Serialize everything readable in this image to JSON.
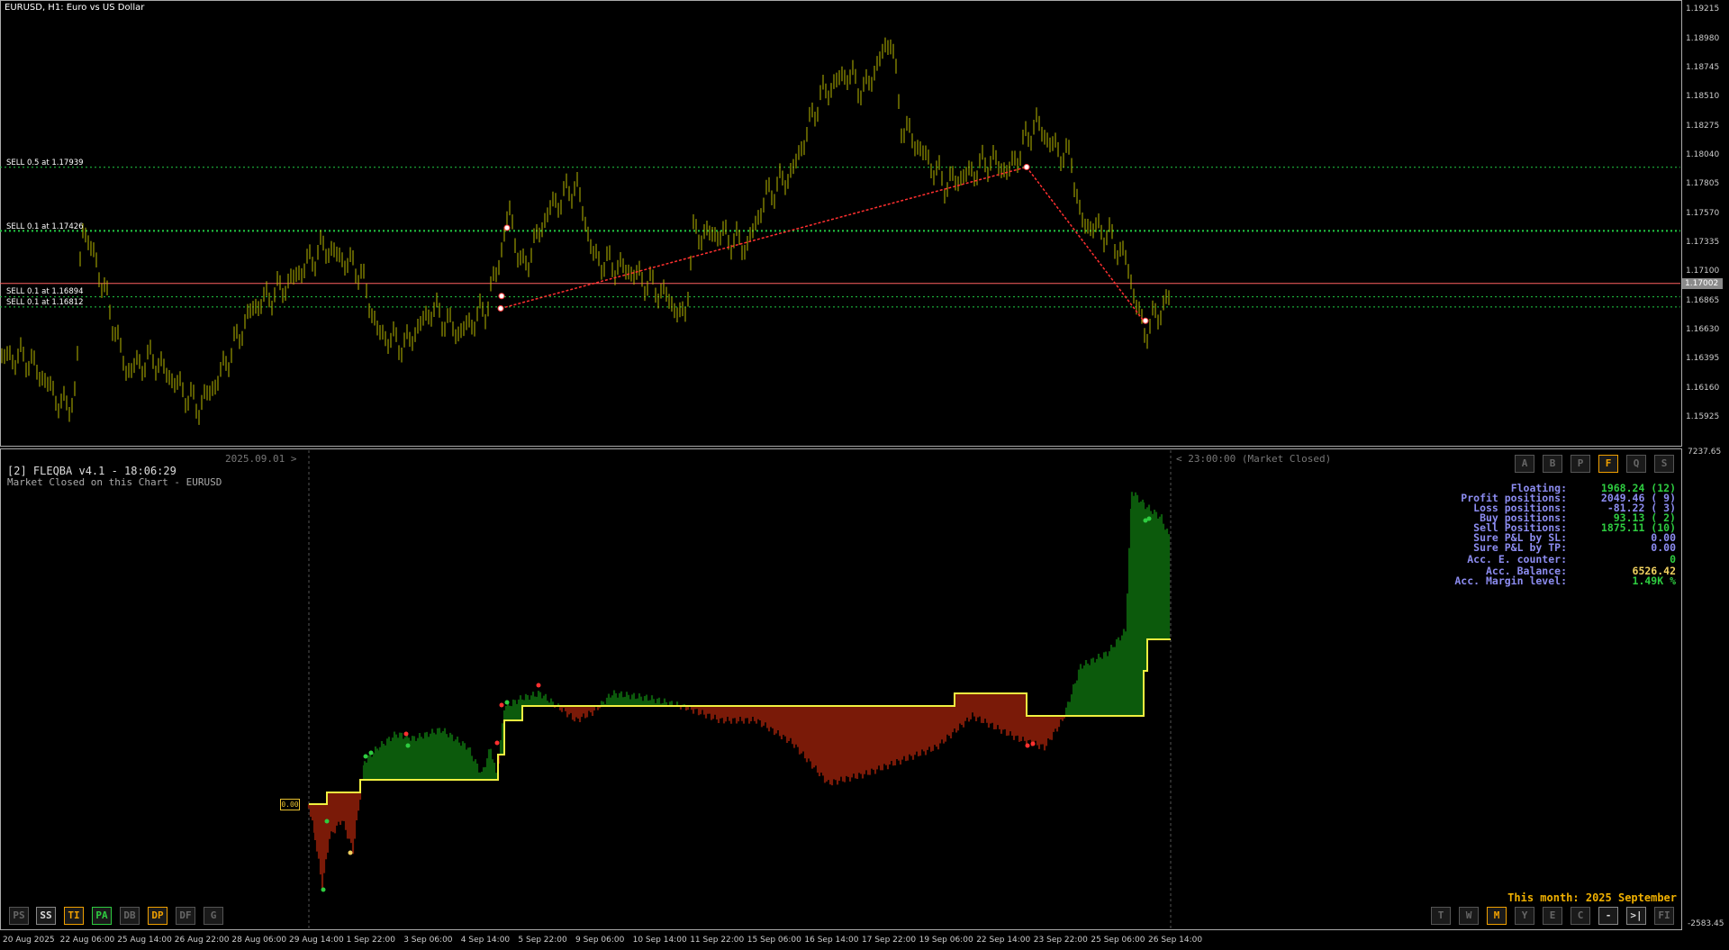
{
  "chart": {
    "title": "EURUSD, H1:  Euro vs US Dollar",
    "current_price": "1.17002",
    "price_ticks": [
      "1.19215",
      "1.18980",
      "1.18745",
      "1.18510",
      "1.18275",
      "1.18040",
      "1.17805",
      "1.17570",
      "1.17335",
      "1.17100",
      "1.16865",
      "1.16630",
      "1.16395",
      "1.16160",
      "1.15925"
    ],
    "sell_levels": [
      {
        "label": "SELL 0.5 at 1.17939",
        "price": 1.17939
      },
      {
        "label": "SELL 0.1 at 1.17426",
        "price": 1.17426
      },
      {
        "label": "SELL 0.1 at 1.16894",
        "price": 1.16894
      },
      {
        "label": "SELL 0.1 at 1.16812",
        "price": 1.16812
      }
    ],
    "time_ticks": [
      "20 Aug 2025",
      "22 Aug 06:00",
      "25 Aug 14:00",
      "26 Aug 22:00",
      "28 Aug 06:00",
      "29 Aug 14:00",
      "1 Sep 22:00",
      "3 Sep 06:00",
      "4 Sep 14:00",
      "5 Sep 22:00",
      "9 Sep 06:00",
      "10 Sep 14:00",
      "11 Sep 22:00",
      "15 Sep 06:00",
      "16 Sep 14:00",
      "17 Sep 22:00",
      "19 Sep 06:00",
      "22 Sep 14:00",
      "23 Sep 22:00",
      "25 Sep 06:00",
      "26 Sep 14:00"
    ],
    "colors": {
      "bars": "#b8b800",
      "sell_line": "#22cc44",
      "price_line": "#ff6060",
      "trade_line": "#ff3030"
    }
  },
  "indicator": {
    "title": "[2] FLEQBA v4.1 - 18:06:29",
    "status": "Market Closed on this Chart - EURUSD",
    "date_left": "2025.09.01 >",
    "date_right": "< 23:00:00 (Market Closed)",
    "zero_label": "0.00",
    "axis_max": "7237.65",
    "axis_min": "-2583.45",
    "this_month": "This month: 2025 September",
    "top_buttons": [
      "A",
      "B",
      "P",
      "F",
      "Q",
      "S"
    ],
    "bottom_left_buttons": [
      "PS",
      "SS",
      "TI",
      "PA",
      "DB",
      "DP",
      "DF",
      "G"
    ],
    "bottom_right_buttons": [
      "T",
      "W",
      "M",
      "Y",
      "E",
      "C",
      "-",
      ">|",
      "FI"
    ],
    "stats": [
      {
        "label": "Floating:",
        "value": "1968.24 (12)",
        "color": "#2ecc40"
      },
      {
        "label": "Profit positions:",
        "value": "2049.46 ( 9)",
        "color": "#8c8cf0"
      },
      {
        "label": "Loss positions:",
        "value": "-81.22 ( 3)",
        "color": "#8c8cf0"
      },
      {
        "label": "Buy positions:",
        "value": "93.13 ( 2)",
        "color": "#2ecc40"
      },
      {
        "label": "Sell Positions:",
        "value": "1875.11 (10)",
        "color": "#2ecc40"
      },
      {
        "label": "Sure P&L by SL:",
        "value": "0.00",
        "color": "#8c8cf0"
      },
      {
        "label": "Sure P&L by TP:",
        "value": "0.00",
        "color": "#8c8cf0"
      },
      {
        "label": "Acc. E. counter:",
        "value": "0",
        "color": "#2ecc40"
      },
      {
        "label": "Acc. Balance:",
        "value": "6526.42",
        "color": "#f0d060"
      },
      {
        "label": "Acc. Margin level:",
        "value": "1.49K %",
        "color": "#2ecc40"
      }
    ]
  }
}
